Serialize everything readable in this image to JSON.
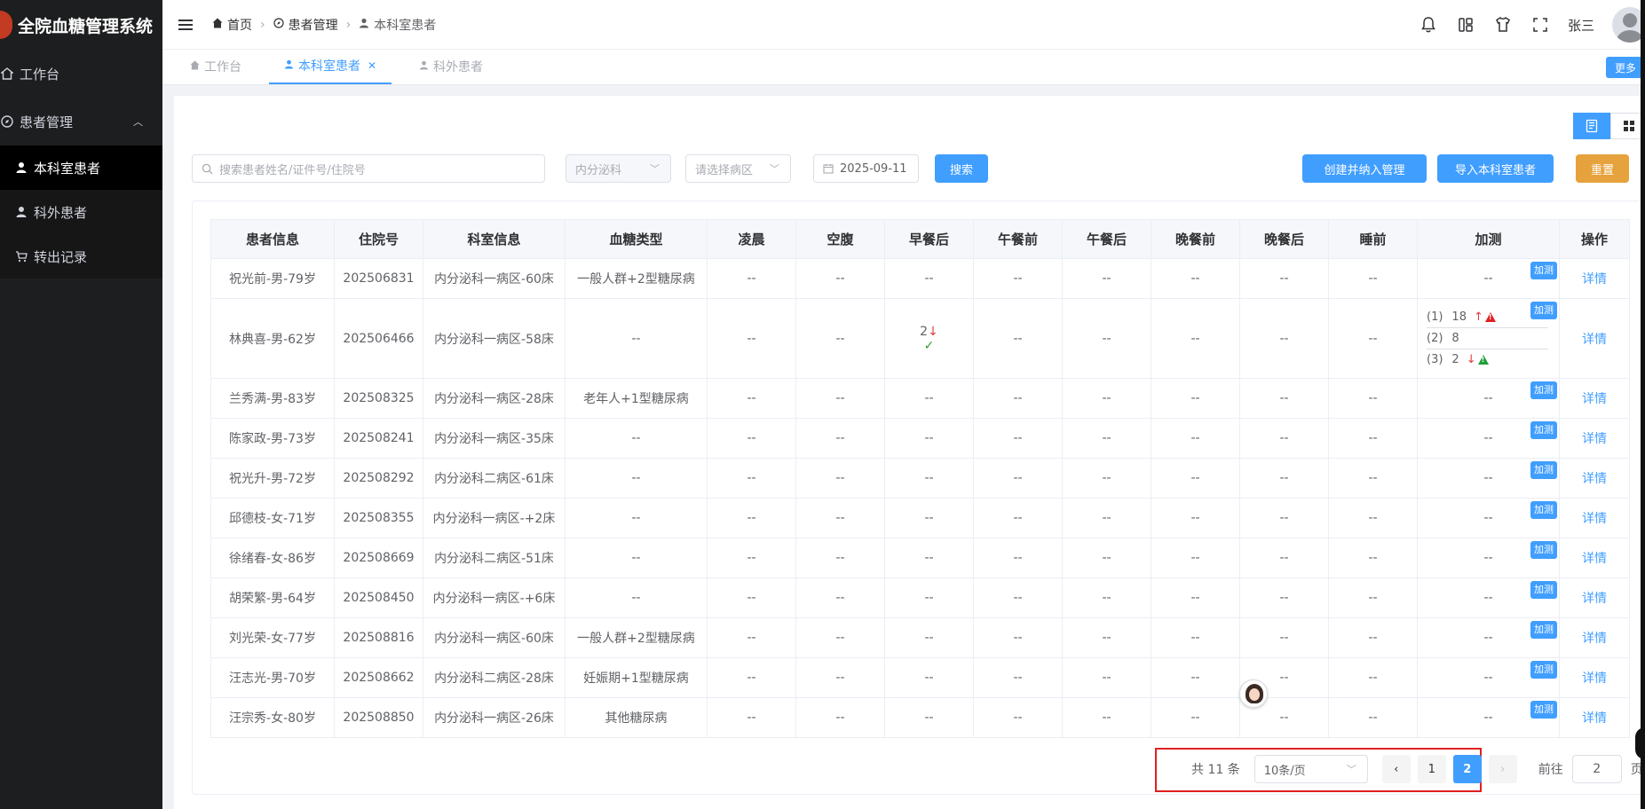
{
  "app": {
    "title": "全院血糖管理系统"
  },
  "sidebar": {
    "items": [
      {
        "label": "工作台"
      },
      {
        "label": "患者管理"
      },
      {
        "label": "本科室患者"
      },
      {
        "label": "科外患者"
      },
      {
        "label": "转出记录"
      }
    ]
  },
  "header": {
    "breadcrumb": [
      "首页",
      "患者管理",
      "本科室患者"
    ],
    "user": "张三"
  },
  "tabs": {
    "items": [
      {
        "label": "工作台"
      },
      {
        "label": "本科室患者"
      },
      {
        "label": "科外患者"
      }
    ],
    "more": "更多"
  },
  "search": {
    "placeholder": "搜索患者姓名/证件号/住院号",
    "department": "内分泌科",
    "ward_placeholder": "请选择病区",
    "date": "2025-09-11",
    "search_btn": "搜索",
    "create_btn": "创建并纳入管理",
    "import_btn": "导入本科室患者",
    "reset_btn": "重置"
  },
  "table": {
    "headers": [
      "患者信息",
      "住院号",
      "科室信息",
      "血糖类型",
      "凌晨",
      "空腹",
      "早餐后",
      "午餐前",
      "午餐后",
      "晚餐前",
      "晚餐后",
      "睡前",
      "加测",
      "操作"
    ],
    "add_label": "加测",
    "detail_label": "详情",
    "rows": [
      {
        "info": "祝光前-男-79岁",
        "no": "202506831",
        "dept": "内分泌科一病区-60床",
        "type": "一般人群+2型糖尿病"
      },
      {
        "info": "林典喜-男-62岁",
        "no": "202506466",
        "dept": "内分泌科一病区-58床",
        "type": "--",
        "breakfast_after": "2",
        "extra": [
          {
            "idx": "(1)",
            "val": "18"
          },
          {
            "idx": "(2)",
            "val": "8"
          },
          {
            "idx": "(3)",
            "val": "2"
          }
        ]
      },
      {
        "info": "兰秀满-男-83岁",
        "no": "202508325",
        "dept": "内分泌科一病区-28床",
        "type": "老年人+1型糖尿病"
      },
      {
        "info": "陈家政-男-73岁",
        "no": "202508241",
        "dept": "内分泌科一病区-35床",
        "type": "--"
      },
      {
        "info": "祝光升-男-72岁",
        "no": "202508292",
        "dept": "内分泌科二病区-61床",
        "type": "--"
      },
      {
        "info": "邱德枝-女-71岁",
        "no": "202508355",
        "dept": "内分泌科一病区-+2床",
        "type": "--"
      },
      {
        "info": "徐绪春-女-86岁",
        "no": "202508669",
        "dept": "内分泌科二病区-51床",
        "type": "--"
      },
      {
        "info": "胡荣繁-男-64岁",
        "no": "202508450",
        "dept": "内分泌科一病区-+6床",
        "type": "--"
      },
      {
        "info": "刘光荣-女-77岁",
        "no": "202508816",
        "dept": "内分泌科一病区-60床",
        "type": "一般人群+2型糖尿病"
      },
      {
        "info": "汪志光-男-70岁",
        "no": "202508662",
        "dept": "内分泌科二病区-28床",
        "type": "妊娠期+1型糖尿病"
      },
      {
        "info": "汪宗秀-女-80岁",
        "no": "202508850",
        "dept": "内分泌科一病区-26床",
        "type": "其他糖尿病"
      }
    ]
  },
  "pager": {
    "total": "共 11 条",
    "size": "10条/页",
    "pages": [
      "1",
      "2"
    ],
    "goto_label": "前往",
    "goto_value": "2",
    "page_unit": "页"
  }
}
